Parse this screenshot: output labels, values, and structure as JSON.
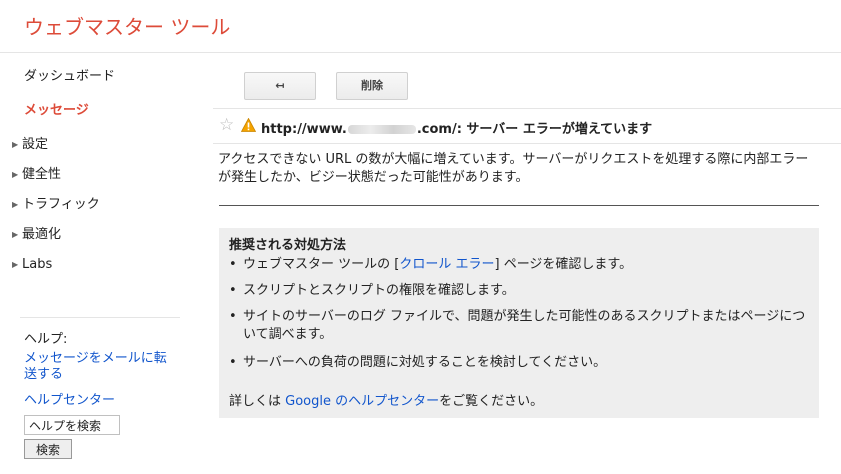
{
  "header": {
    "title": "ウェブマスター ツール"
  },
  "sidebar": {
    "items": [
      {
        "label": "ダッシュボード",
        "has_arrow": false,
        "active": false
      },
      {
        "label": "メッセージ",
        "has_arrow": false,
        "active": true
      },
      {
        "label": "設定",
        "has_arrow": true,
        "active": false
      },
      {
        "label": "健全性",
        "has_arrow": true,
        "active": false
      },
      {
        "label": "トラフィック",
        "has_arrow": true,
        "active": false
      },
      {
        "label": "最適化",
        "has_arrow": true,
        "active": false
      },
      {
        "label": "Labs",
        "has_arrow": true,
        "active": false
      }
    ],
    "help": {
      "title": "ヘルプ:",
      "forward_link": "メッセージをメールに転送する",
      "help_center_link": "ヘルプセンター",
      "search_value": "ヘルプを検索",
      "search_button": "検索"
    }
  },
  "toolbar": {
    "back_icon": "↤",
    "delete_label": "削除"
  },
  "message": {
    "star_icon": "☆",
    "subject_prefix": "http://www.",
    "subject_suffix": ".com/: サーバー エラーが増えています",
    "body": "アクセスできない URL の数が大幅に増えています。サーバーがリクエストを処理する際に内部エラーが発生したか、ビジー状態だった可能性があります。",
    "recommendations": {
      "title": "推奨される対処方法",
      "bullet": "•",
      "item1_before": "ウェブマスター ツールの [",
      "item1_link": "クロール エラー",
      "item1_after": "] ページを確認します。",
      "item2": "スクリプトとスクリプトの権限を確認します。",
      "item3": "サイトのサーバーのログ ファイルで、問題が発生した可能性のあるスクリプトまたはページについて調べます。",
      "item4": "サーバーへの負荷の問題に対処することを検討してください。",
      "footer_before": "詳しくは ",
      "footer_link": "Google のヘルプセンター",
      "footer_after": "をご覧ください。"
    }
  },
  "colors": {
    "brand": "#dd4b39",
    "link": "#1155cc",
    "warning": "#f4a300"
  }
}
